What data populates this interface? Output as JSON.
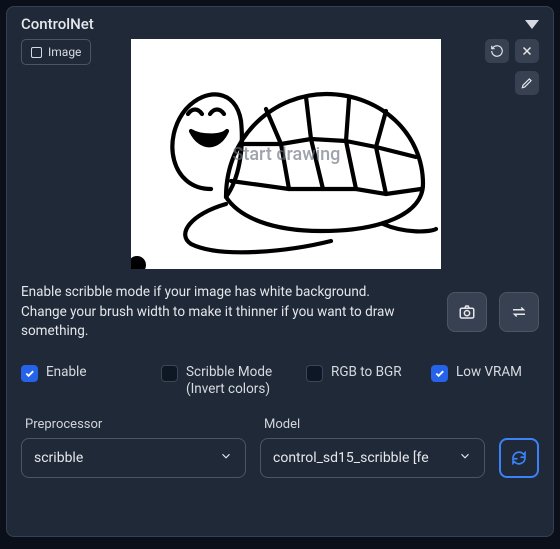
{
  "header": {
    "title": "ControlNet"
  },
  "imageTab": {
    "label": "Image"
  },
  "canvas": {
    "watermark": "Start drawing"
  },
  "help": {
    "line1": "Enable scribble mode if your image has white background.",
    "line2": "Change your brush width to make it thinner if you want to draw something."
  },
  "checks": {
    "enable": {
      "label": "Enable",
      "checked": true
    },
    "scribble": {
      "label": "Scribble Mode (Invert colors)",
      "checked": false
    },
    "rgb": {
      "label": "RGB to BGR",
      "checked": false
    },
    "lowvram": {
      "label": "Low VRAM",
      "checked": true
    }
  },
  "preproc": {
    "label": "Preprocessor",
    "value": "scribble"
  },
  "model": {
    "label": "Model",
    "value": "control_sd15_scribble [fe"
  }
}
